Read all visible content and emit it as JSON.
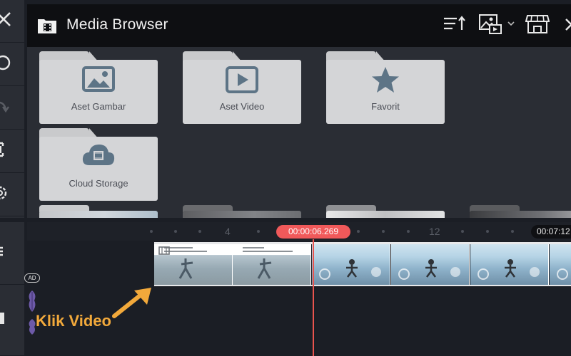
{
  "header": {
    "title": "Media Browser",
    "icons": {
      "title_icon": "film-folder-icon",
      "sort": "sort-icon",
      "media_filter": "image-filter-icon",
      "store": "store-icon",
      "close": "close-icon"
    }
  },
  "left_toolbar": {
    "items": [
      {
        "icon": "close-icon"
      },
      {
        "icon": "undo-circle-icon"
      },
      {
        "icon": "redo-icon"
      },
      {
        "icon": "capture-frame-icon"
      },
      {
        "icon": "settings-icon"
      },
      {
        "icon": "layers-menu-icon"
      },
      {
        "icon": "stop-icon"
      }
    ]
  },
  "folders": [
    {
      "label": "Aset Gambar",
      "icon": "image-icon"
    },
    {
      "label": "Aset Video",
      "icon": "video-play-icon"
    },
    {
      "label": "Favorit",
      "icon": "star-icon"
    },
    {
      "label": "Cloud Storage",
      "icon": "cloud-video-icon"
    }
  ],
  "timeline": {
    "ruler_labels": [
      "4",
      "12"
    ],
    "playhead_time": "00:00:06.269",
    "end_time": "00:07:12",
    "ad_badge": "AD"
  },
  "hint": {
    "label": "Klik Video"
  },
  "colors": {
    "accent": "#f0595a",
    "hint": "#f2a93b",
    "panel": "#2a2d34",
    "header": "#0e0f12"
  }
}
